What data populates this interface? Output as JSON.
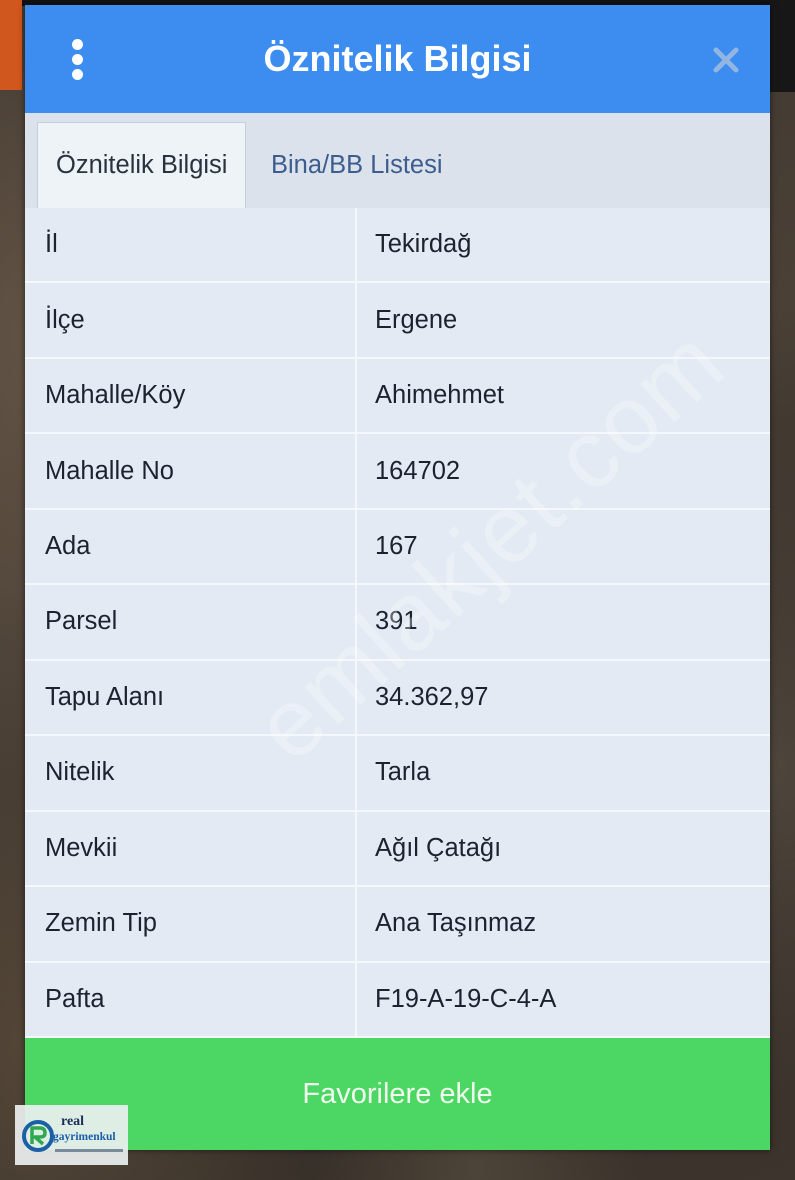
{
  "header": {
    "title": "Öznitelik Bilgisi",
    "menu_icon": "kebab-menu-icon",
    "close_icon": "close-icon"
  },
  "tabs": [
    {
      "label": "Öznitelik Bilgisi",
      "active": true
    },
    {
      "label": "Bina/BB Listesi",
      "active": false
    }
  ],
  "attributes": [
    {
      "label": "İl",
      "value": "Tekirdağ"
    },
    {
      "label": "İlçe",
      "value": "Ergene"
    },
    {
      "label": "Mahalle/Köy",
      "value": "Ahimehmet"
    },
    {
      "label": "Mahalle No",
      "value": "164702"
    },
    {
      "label": "Ada",
      "value": "167"
    },
    {
      "label": "Parsel",
      "value": "391"
    },
    {
      "label": "Tapu Alanı",
      "value": "34.362,97"
    },
    {
      "label": "Nitelik",
      "value": "Tarla"
    },
    {
      "label": "Mevkii",
      "value": "Ağıl Çatağı"
    },
    {
      "label": "Zemin Tip",
      "value": "Ana Taşınmaz"
    },
    {
      "label": "Pafta",
      "value": "F19-A-19-C-4-A"
    }
  ],
  "footer": {
    "button_label": "Favorilere ekle"
  },
  "watermark": "emlakjet.com",
  "logo": {
    "name_top": "real",
    "name_bottom": "gayrimenkul"
  },
  "colors": {
    "header": "#3d8df0",
    "table_bg": "#e3eaf3",
    "button": "#4cd663",
    "tab_inactive_text": "#3d5d8f"
  }
}
